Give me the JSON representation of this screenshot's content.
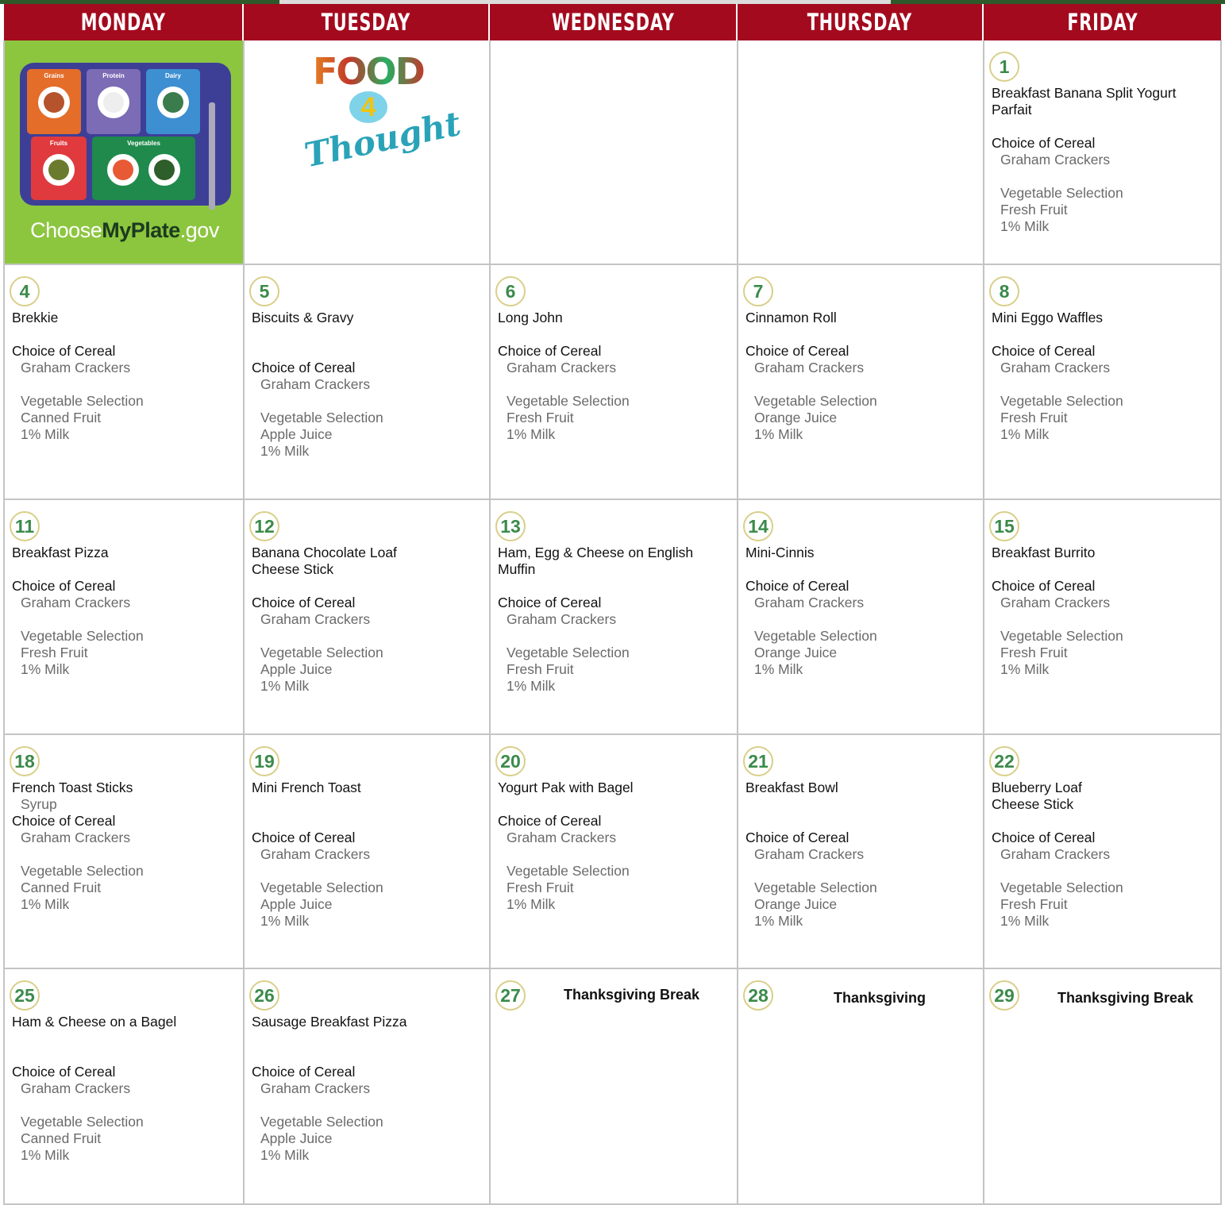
{
  "header": {
    "days": [
      "MONDAY",
      "TUESDAY",
      "WEDNESDAY",
      "THURSDAY",
      "FRIDAY"
    ]
  },
  "logos": {
    "myplate": {
      "prefix": "Choose",
      "brand": "MyPlate",
      "suffix": ".gov",
      "sections": [
        "Grains",
        "Protein",
        "Dairy",
        "Fruits",
        "Vegetables"
      ]
    },
    "food4thought": {
      "food": "FOOD",
      "four": "4",
      "thought": "Thought"
    }
  },
  "colors": {
    "header_bg": "#a30a1e",
    "number_green": "#3b8a4a",
    "number_ring": "#d9cf8a",
    "myplate_green": "#8cc63f"
  },
  "weeks": [
    {
      "days": [
        {
          "special": "myplate"
        },
        {
          "special": "food4thought"
        },
        {
          "empty": true
        },
        {
          "empty": true
        },
        {
          "num": "1",
          "lines": [
            {
              "t": "Breakfast Banana Split Yogurt",
              "s": "main"
            },
            {
              "t": "Parfait",
              "s": "main"
            },
            {
              "t": "",
              "s": "blank"
            },
            {
              "t": "Choice of Cereal",
              "s": "main"
            },
            {
              "t": "Graham Crackers",
              "s": "sub"
            },
            {
              "t": "",
              "s": "blank"
            },
            {
              "t": "Vegetable Selection",
              "s": "sub"
            },
            {
              "t": "Fresh Fruit",
              "s": "sub"
            },
            {
              "t": "1% Milk",
              "s": "sub"
            }
          ]
        }
      ]
    },
    {
      "days": [
        {
          "num": "4",
          "lines": [
            {
              "t": "Brekkie",
              "s": "main"
            },
            {
              "t": "",
              "s": "blank"
            },
            {
              "t": "Choice of Cereal",
              "s": "main"
            },
            {
              "t": "Graham Crackers",
              "s": "sub"
            },
            {
              "t": "",
              "s": "blank"
            },
            {
              "t": "Vegetable Selection",
              "s": "sub"
            },
            {
              "t": "Canned Fruit",
              "s": "sub"
            },
            {
              "t": "1% Milk",
              "s": "sub"
            }
          ]
        },
        {
          "num": "5",
          "lines": [
            {
              "t": "Biscuits & Gravy",
              "s": "main"
            },
            {
              "t": "",
              "s": "blank"
            },
            {
              "t": "",
              "s": "blank"
            },
            {
              "t": "Choice of Cereal",
              "s": "main"
            },
            {
              "t": "Graham Crackers",
              "s": "sub"
            },
            {
              "t": "",
              "s": "blank"
            },
            {
              "t": "Vegetable Selection",
              "s": "sub"
            },
            {
              "t": "Apple Juice",
              "s": "sub"
            },
            {
              "t": "1% Milk",
              "s": "sub"
            }
          ]
        },
        {
          "num": "6",
          "lines": [
            {
              "t": "Long John",
              "s": "main"
            },
            {
              "t": "",
              "s": "blank"
            },
            {
              "t": "Choice of Cereal",
              "s": "main"
            },
            {
              "t": "Graham Crackers",
              "s": "sub"
            },
            {
              "t": "",
              "s": "blank"
            },
            {
              "t": "Vegetable Selection",
              "s": "sub"
            },
            {
              "t": "Fresh Fruit",
              "s": "sub"
            },
            {
              "t": "1% Milk",
              "s": "sub"
            }
          ]
        },
        {
          "num": "7",
          "lines": [
            {
              "t": "Cinnamon Roll",
              "s": "main"
            },
            {
              "t": "",
              "s": "blank"
            },
            {
              "t": "Choice of Cereal",
              "s": "main"
            },
            {
              "t": "Graham Crackers",
              "s": "sub"
            },
            {
              "t": "",
              "s": "blank"
            },
            {
              "t": "Vegetable Selection",
              "s": "sub"
            },
            {
              "t": "Orange Juice",
              "s": "sub"
            },
            {
              "t": "1% Milk",
              "s": "sub"
            }
          ]
        },
        {
          "num": "8",
          "lines": [
            {
              "t": "Mini Eggo Waffles",
              "s": "main"
            },
            {
              "t": "",
              "s": "blank"
            },
            {
              "t": "Choice of Cereal",
              "s": "main"
            },
            {
              "t": "Graham Crackers",
              "s": "sub"
            },
            {
              "t": "",
              "s": "blank"
            },
            {
              "t": "Vegetable Selection",
              "s": "sub"
            },
            {
              "t": "Fresh Fruit",
              "s": "sub"
            },
            {
              "t": "1% Milk",
              "s": "sub"
            }
          ]
        }
      ]
    },
    {
      "days": [
        {
          "num": "11",
          "lines": [
            {
              "t": "Breakfast Pizza",
              "s": "main"
            },
            {
              "t": "",
              "s": "blank"
            },
            {
              "t": "Choice of Cereal",
              "s": "main"
            },
            {
              "t": "Graham Crackers",
              "s": "sub"
            },
            {
              "t": "",
              "s": "blank"
            },
            {
              "t": "Vegetable Selection",
              "s": "sub"
            },
            {
              "t": "Fresh Fruit",
              "s": "sub"
            },
            {
              "t": "1% Milk",
              "s": "sub"
            }
          ]
        },
        {
          "num": "12",
          "lines": [
            {
              "t": "Banana Chocolate Loaf",
              "s": "main"
            },
            {
              "t": "Cheese Stick",
              "s": "main"
            },
            {
              "t": "",
              "s": "blank"
            },
            {
              "t": "Choice of Cereal",
              "s": "main"
            },
            {
              "t": "Graham Crackers",
              "s": "sub"
            },
            {
              "t": "",
              "s": "blank"
            },
            {
              "t": "Vegetable Selection",
              "s": "sub"
            },
            {
              "t": "Apple Juice",
              "s": "sub"
            },
            {
              "t": "1% Milk",
              "s": "sub"
            }
          ]
        },
        {
          "num": "13",
          "lines": [
            {
              "t": "Ham, Egg & Cheese on English",
              "s": "main"
            },
            {
              "t": "Muffin",
              "s": "main"
            },
            {
              "t": "",
              "s": "blank"
            },
            {
              "t": "Choice of Cereal",
              "s": "main"
            },
            {
              "t": "Graham Crackers",
              "s": "sub"
            },
            {
              "t": "",
              "s": "blank"
            },
            {
              "t": "Vegetable Selection",
              "s": "sub"
            },
            {
              "t": "Fresh Fruit",
              "s": "sub"
            },
            {
              "t": "1% Milk",
              "s": "sub"
            }
          ]
        },
        {
          "num": "14",
          "lines": [
            {
              "t": "Mini-Cinnis",
              "s": "main"
            },
            {
              "t": "",
              "s": "blank"
            },
            {
              "t": "Choice of Cereal",
              "s": "main"
            },
            {
              "t": "Graham Crackers",
              "s": "sub"
            },
            {
              "t": "",
              "s": "blank"
            },
            {
              "t": "Vegetable Selection",
              "s": "sub"
            },
            {
              "t": "Orange Juice",
              "s": "sub"
            },
            {
              "t": "1% Milk",
              "s": "sub"
            }
          ]
        },
        {
          "num": "15",
          "lines": [
            {
              "t": "Breakfast Burrito",
              "s": "main"
            },
            {
              "t": "",
              "s": "blank"
            },
            {
              "t": "Choice of Cereal",
              "s": "main"
            },
            {
              "t": "Graham Crackers",
              "s": "sub"
            },
            {
              "t": "",
              "s": "blank"
            },
            {
              "t": "Vegetable Selection",
              "s": "sub"
            },
            {
              "t": "Fresh Fruit",
              "s": "sub"
            },
            {
              "t": "1% Milk",
              "s": "sub"
            }
          ]
        }
      ]
    },
    {
      "days": [
        {
          "num": "18",
          "lines": [
            {
              "t": "French Toast Sticks",
              "s": "main"
            },
            {
              "t": "Syrup",
              "s": "sub"
            },
            {
              "t": "Choice of Cereal",
              "s": "main"
            },
            {
              "t": "Graham Crackers",
              "s": "sub"
            },
            {
              "t": "",
              "s": "blank"
            },
            {
              "t": "Vegetable Selection",
              "s": "sub"
            },
            {
              "t": "Canned Fruit",
              "s": "sub"
            },
            {
              "t": "1% Milk",
              "s": "sub"
            }
          ]
        },
        {
          "num": "19",
          "lines": [
            {
              "t": "Mini French Toast",
              "s": "main"
            },
            {
              "t": "",
              "s": "blank"
            },
            {
              "t": "",
              "s": "blank"
            },
            {
              "t": "Choice of Cereal",
              "s": "main"
            },
            {
              "t": "Graham Crackers",
              "s": "sub"
            },
            {
              "t": "",
              "s": "blank"
            },
            {
              "t": "Vegetable Selection",
              "s": "sub"
            },
            {
              "t": "Apple Juice",
              "s": "sub"
            },
            {
              "t": "1% Milk",
              "s": "sub"
            }
          ]
        },
        {
          "num": "20",
          "lines": [
            {
              "t": "Yogurt Pak with Bagel",
              "s": "main"
            },
            {
              "t": "",
              "s": "blank"
            },
            {
              "t": "Choice of Cereal",
              "s": "main"
            },
            {
              "t": "Graham Crackers",
              "s": "sub"
            },
            {
              "t": "",
              "s": "blank"
            },
            {
              "t": "Vegetable Selection",
              "s": "sub"
            },
            {
              "t": "Fresh Fruit",
              "s": "sub"
            },
            {
              "t": "1% Milk",
              "s": "sub"
            }
          ]
        },
        {
          "num": "21",
          "lines": [
            {
              "t": "Breakfast Bowl",
              "s": "main"
            },
            {
              "t": "",
              "s": "blank"
            },
            {
              "t": "",
              "s": "blank"
            },
            {
              "t": "Choice of Cereal",
              "s": "main"
            },
            {
              "t": "Graham Crackers",
              "s": "sub"
            },
            {
              "t": "",
              "s": "blank"
            },
            {
              "t": "Vegetable Selection",
              "s": "sub"
            },
            {
              "t": "Orange Juice",
              "s": "sub"
            },
            {
              "t": "1% Milk",
              "s": "sub"
            }
          ]
        },
        {
          "num": "22",
          "lines": [
            {
              "t": "Blueberry Loaf",
              "s": "main"
            },
            {
              "t": "Cheese Stick",
              "s": "main"
            },
            {
              "t": "",
              "s": "blank"
            },
            {
              "t": "Choice of Cereal",
              "s": "main"
            },
            {
              "t": "Graham Crackers",
              "s": "sub"
            },
            {
              "t": "",
              "s": "blank"
            },
            {
              "t": "Vegetable Selection",
              "s": "sub"
            },
            {
              "t": "Fresh Fruit",
              "s": "sub"
            },
            {
              "t": "1% Milk",
              "s": "sub"
            }
          ]
        }
      ]
    },
    {
      "days": [
        {
          "num": "25",
          "lines": [
            {
              "t": "Ham & Cheese on a Bagel",
              "s": "main"
            },
            {
              "t": "",
              "s": "blank"
            },
            {
              "t": "",
              "s": "blank"
            },
            {
              "t": "Choice of Cereal",
              "s": "main"
            },
            {
              "t": "Graham Crackers",
              "s": "sub"
            },
            {
              "t": "",
              "s": "blank"
            },
            {
              "t": "Vegetable Selection",
              "s": "sub"
            },
            {
              "t": "Canned Fruit",
              "s": "sub"
            },
            {
              "t": "1% Milk",
              "s": "sub"
            }
          ]
        },
        {
          "num": "26",
          "lines": [
            {
              "t": "Sausage Breakfast Pizza",
              "s": "main"
            },
            {
              "t": "",
              "s": "blank"
            },
            {
              "t": "",
              "s": "blank"
            },
            {
              "t": "Choice of Cereal",
              "s": "main"
            },
            {
              "t": "Graham Crackers",
              "s": "sub"
            },
            {
              "t": "",
              "s": "blank"
            },
            {
              "t": "Vegetable Selection",
              "s": "sub"
            },
            {
              "t": "Apple Juice",
              "s": "sub"
            },
            {
              "t": "1% Milk",
              "s": "sub"
            }
          ]
        },
        {
          "num": "27",
          "break": "Thanksgiving Break"
        },
        {
          "num": "28",
          "break": "Thanksgiving"
        },
        {
          "num": "29",
          "break": "Thanksgiving Break"
        }
      ]
    }
  ]
}
